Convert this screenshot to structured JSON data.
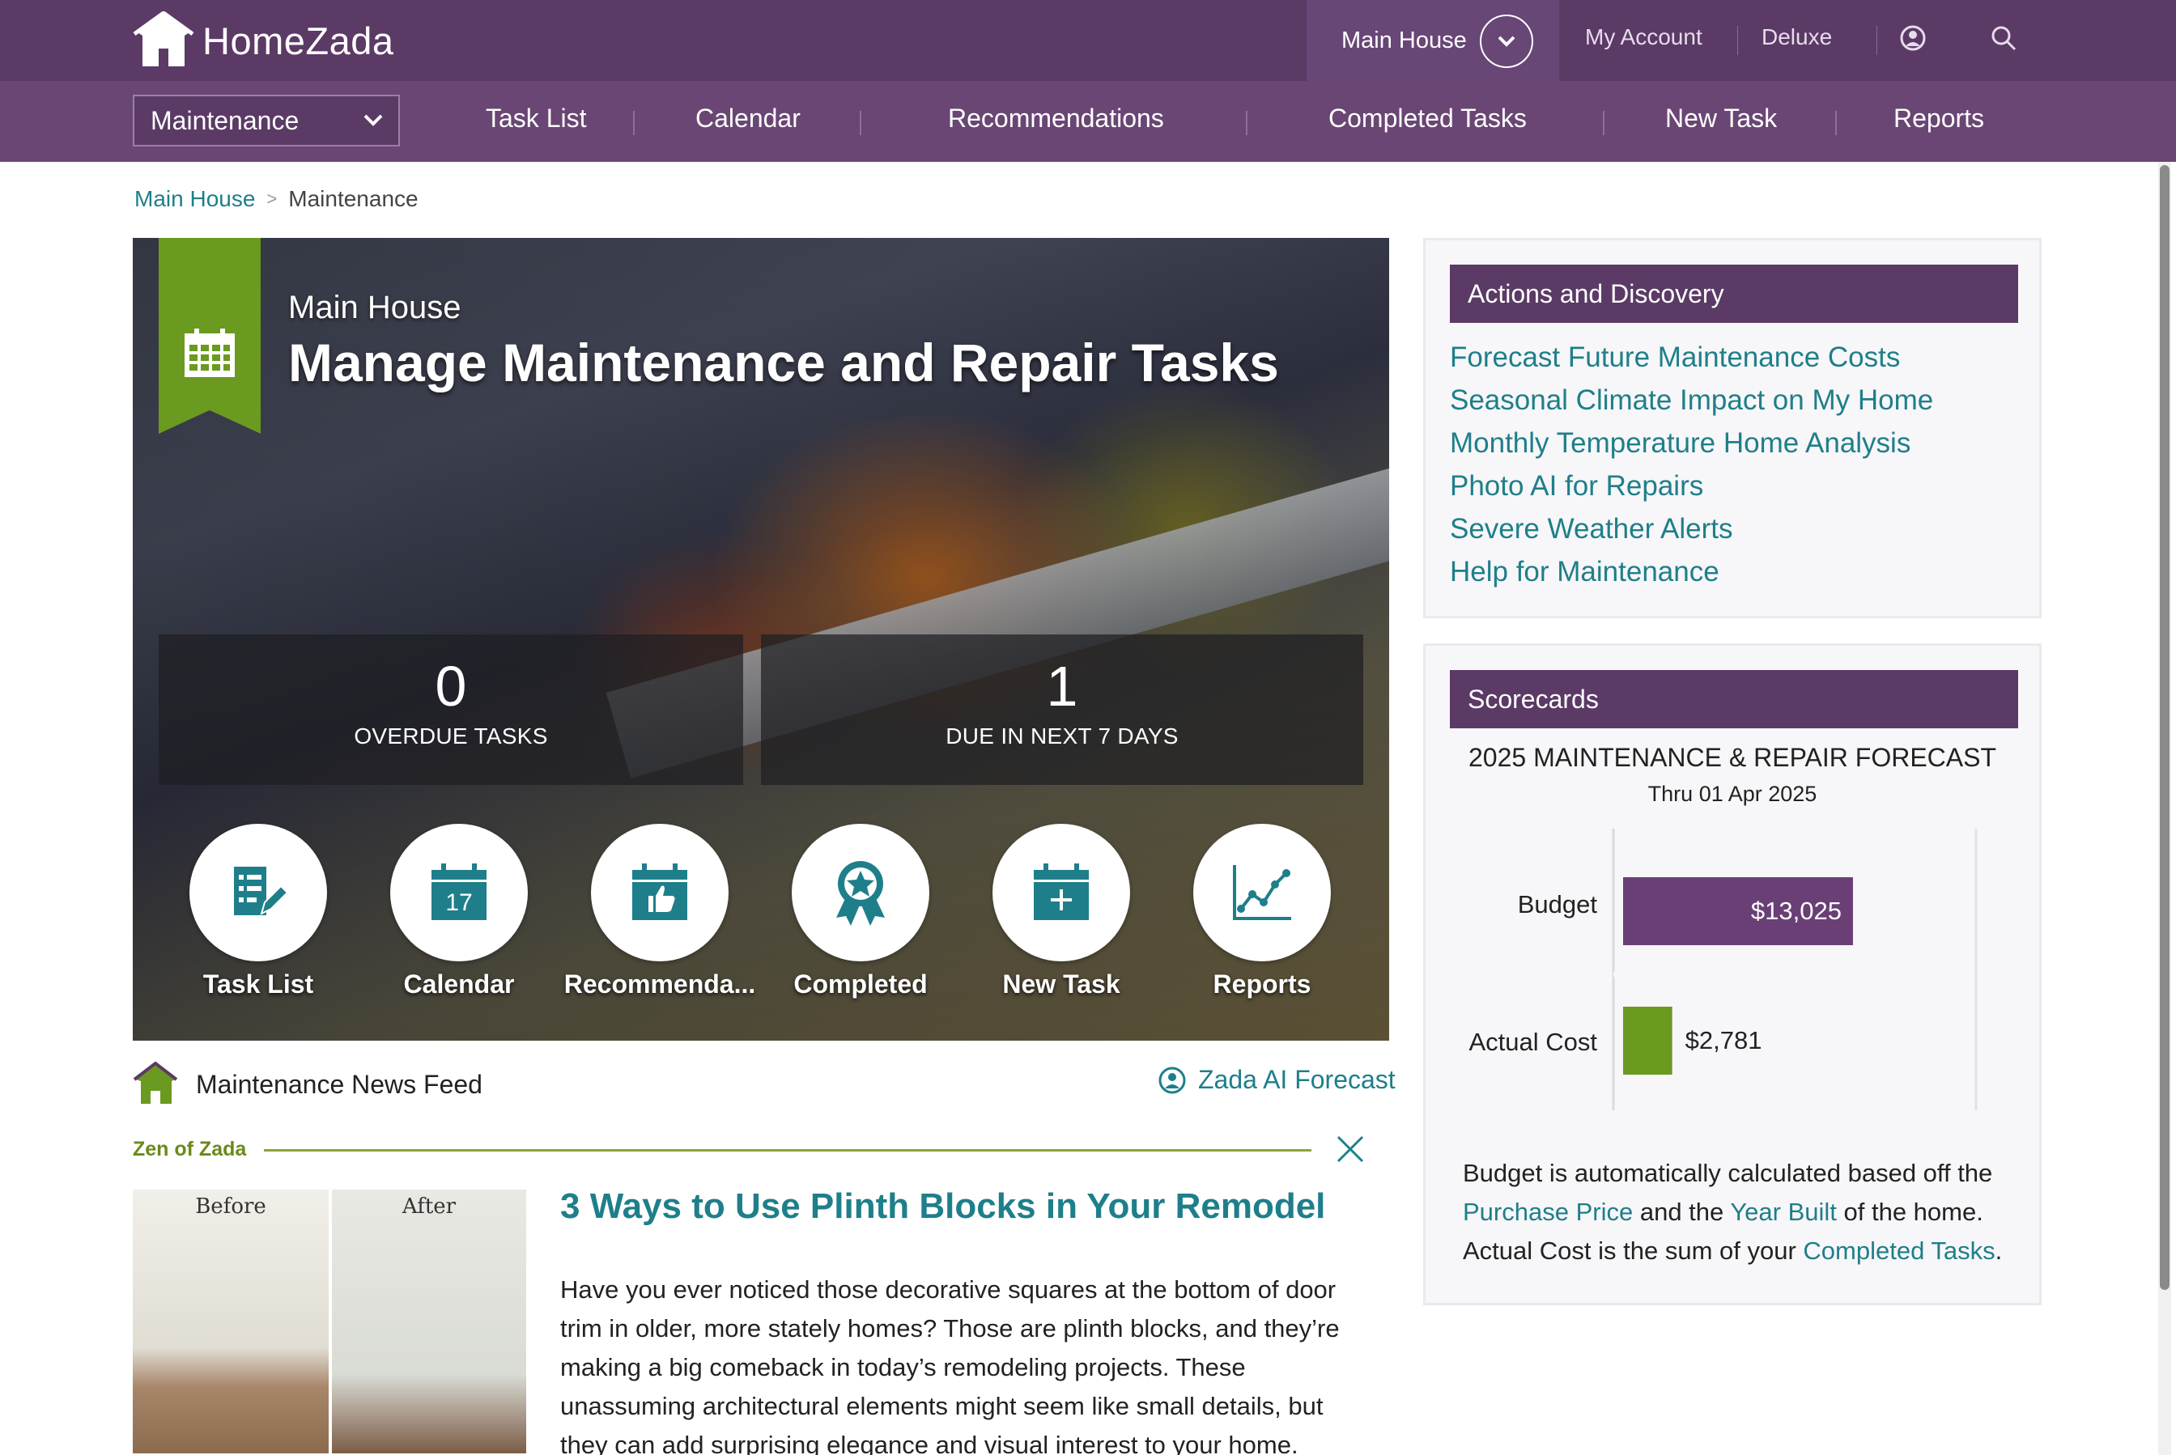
{
  "app": {
    "name": "HomeZada"
  },
  "header": {
    "house_selector": "Main House",
    "links": [
      "My Account",
      "Deluxe"
    ]
  },
  "nav": {
    "section_select": "Maintenance",
    "items": [
      "Task List",
      "Calendar",
      "Recommendations",
      "Completed Tasks",
      "New Task",
      "Reports"
    ]
  },
  "breadcrumb": {
    "home": "Main House",
    "separator": ">",
    "current": "Maintenance"
  },
  "hero": {
    "subtitle": "Main House",
    "title": "Manage Maintenance and Repair Tasks",
    "stats": [
      {
        "value": "0",
        "label": "OVERDUE TASKS"
      },
      {
        "value": "1",
        "label": "DUE IN NEXT 7 DAYS"
      }
    ],
    "shortcuts": [
      {
        "label": "Task List",
        "icon": "task-list-icon"
      },
      {
        "label": "Calendar",
        "icon": "calendar-icon",
        "day": "17"
      },
      {
        "label": "Recommenda...",
        "icon": "thumbs-up-calendar-icon"
      },
      {
        "label": "Completed",
        "icon": "award-ribbon-icon"
      },
      {
        "label": "New Task",
        "icon": "add-calendar-icon"
      },
      {
        "label": "Reports",
        "icon": "line-chart-icon"
      }
    ]
  },
  "feed": {
    "title": "Maintenance News Feed",
    "forecast_link": "Zada AI Forecast",
    "section_label": "Zen of Zada",
    "article": {
      "image_before": "Before",
      "image_after": "After",
      "title": "3 Ways to Use Plinth Blocks in Your Remodel",
      "body": "Have you ever noticed those decorative squares at the bottom of door trim in older, more stately homes? Those are plinth blocks, and they’re making a big comeback in today’s remodeling projects.  These unassuming architectural elements might seem like small details, but they can add surprising elegance and visual interest to your home."
    }
  },
  "actions": {
    "title": "Actions and Discovery",
    "links": [
      "Forecast Future Maintenance Costs",
      "Seasonal Climate Impact on My Home",
      "Monthly Temperature Home Analysis",
      "Photo AI for Repairs",
      "Severe Weather Alerts",
      "Help for Maintenance"
    ]
  },
  "scorecards": {
    "title": "Scorecards",
    "note": {
      "p1": "Budget is automatically calculated based off the ",
      "link1": "Purchase Price",
      "p2": " and the ",
      "link2": "Year Built",
      "p3": " of the home. Actual Cost is the sum of your ",
      "link3": "Completed Tasks",
      "p4": "."
    }
  },
  "colors": {
    "primary": "#5b3a66",
    "nav": "#6a4674",
    "accent": "#1e7f8a",
    "green": "#6a9a1f"
  },
  "chart_data": {
    "type": "bar",
    "title": "2025 MAINTENANCE & REPAIR FORECAST",
    "subtitle": "Thru 01 Apr 2025",
    "categories": [
      "Budget",
      "Actual Cost"
    ],
    "values": [
      13025,
      2781
    ],
    "value_labels": [
      "$13,025",
      "$2,781"
    ],
    "colors": [
      "#6a3f75",
      "#6a9a1f"
    ],
    "orientation": "horizontal",
    "xlim": [
      0,
      20000
    ]
  }
}
